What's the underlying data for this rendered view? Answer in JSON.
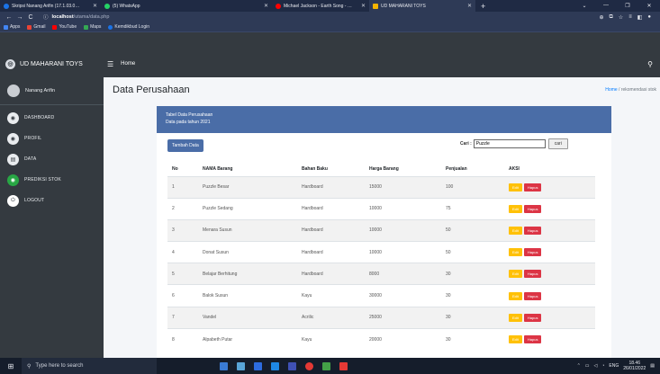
{
  "browser": {
    "tabs": [
      {
        "title": "Skripsi Nanang Arifin (17.1.03.0…",
        "color": "#1a73e8",
        "active": false
      },
      {
        "title": "(5) WhatsApp",
        "color": "#25d366",
        "active": false
      },
      {
        "title": "Michael Jackson - Earth Song - …",
        "color": "#ff0000",
        "active": false
      },
      {
        "title": "UD MAHARANI TOYS",
        "color": "#f4b400",
        "active": true
      }
    ],
    "new_tab": "+",
    "url_host": "localhost",
    "url_path": "/utama/data.php",
    "bookmarks": [
      {
        "label": "Apps",
        "color": "#4285f4"
      },
      {
        "label": "Gmail",
        "color": "#ea4335"
      },
      {
        "label": "YouTube",
        "color": "#ff0000"
      },
      {
        "label": "Maps",
        "color": "#34a853"
      },
      {
        "label": "Kemdikbud Login",
        "color": "#1a73e8"
      }
    ]
  },
  "app": {
    "brand": "UD MAHARANI TOYS",
    "nav_home": "Home",
    "user_name": "Nanang Arifin",
    "menu": [
      {
        "label": "DASHBOARD",
        "icon": "dashboard-icon"
      },
      {
        "label": "PROFIL",
        "icon": "profile-icon"
      },
      {
        "label": "DATA",
        "icon": "data-icon"
      },
      {
        "label": "PREDIKSI STOK",
        "icon": "prediction-icon"
      },
      {
        "label": "LOGOUT",
        "icon": "logout-icon"
      }
    ]
  },
  "page": {
    "title": "Data Perusahaan",
    "breadcrumb_home": "Home",
    "breadcrumb_sep": "/",
    "breadcrumb_current": "rekomendasi stok",
    "card_title": "Tabel Data Perusahaan",
    "card_subtitle": "Data pada tahun 2021",
    "add_button": "Tambah Data",
    "search_label": "Cari :",
    "search_value": "Puzzle",
    "search_button": "cari"
  },
  "table": {
    "headers": [
      "No",
      "NAMA Barang",
      "Bahan Baku",
      "Harga Barang",
      "Penjualan",
      "AKSI"
    ],
    "edit_label": "Edit",
    "delete_label": "Hapus",
    "rows": [
      [
        "1",
        "Puzzle Besar",
        "Hardboard",
        "15000",
        "100"
      ],
      [
        "2",
        "Puzzle Sedang",
        "Hardboard",
        "10000",
        "75"
      ],
      [
        "3",
        "Menara Susun",
        "Hardboard",
        "10000",
        "50"
      ],
      [
        "4",
        "Donat Susun",
        "Hardboard",
        "10000",
        "50"
      ],
      [
        "5",
        "Belajar Berhitung",
        "Hardboard",
        "8000",
        "30"
      ],
      [
        "6",
        "Balok Susun",
        "Kayu",
        "30000",
        "30"
      ],
      [
        "7",
        "Vandel",
        "Acrilic",
        "25000",
        "30"
      ],
      [
        "8",
        "Alpabeth Putar",
        "Kayu",
        "20000",
        "30"
      ]
    ]
  },
  "taskbar": {
    "search_placeholder": "Type here to search",
    "lang": "ENG",
    "time": "18.46",
    "date": "26/01/2022"
  }
}
